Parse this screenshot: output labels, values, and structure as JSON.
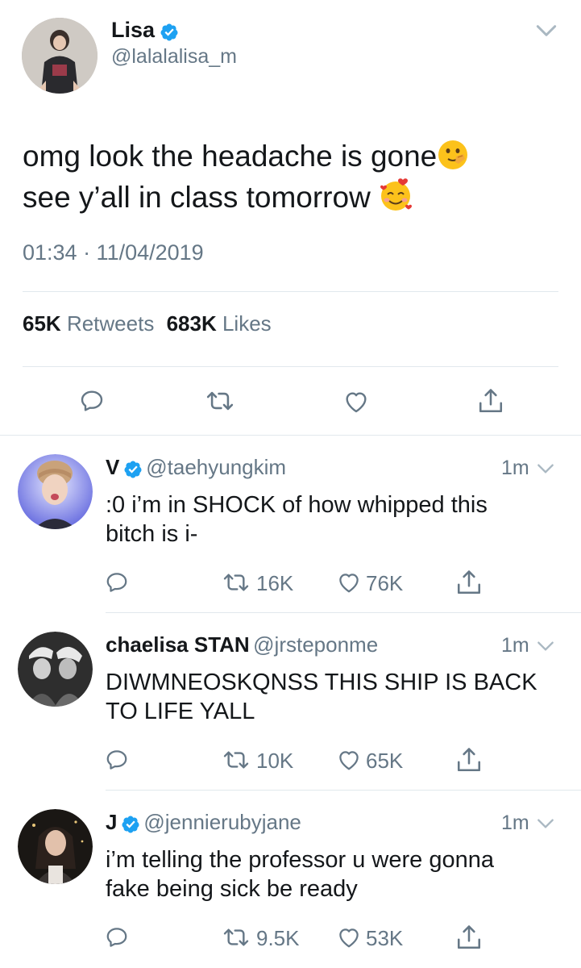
{
  "main_tweet": {
    "name": "Lisa",
    "handle": "@lalalalisa_m",
    "text_line1": "omg look the headache is gone",
    "text_line2": "see y’all in class tomorrow",
    "timestamp": "01:34 · 11/04/2019",
    "retweets_count": "65K",
    "retweets_label": "Retweets",
    "likes_count": "683K",
    "likes_label": "Likes"
  },
  "replies": [
    {
      "name": "V",
      "verified": true,
      "handle": "@taehyungkim",
      "time": "1m",
      "line1": ":0 i’m in SHOCK of how whipped this",
      "line2": "bitch is i-",
      "retweets": "16K",
      "likes": "76K"
    },
    {
      "name": "chaelisa STAN",
      "verified": false,
      "handle": "@jrsteponme",
      "time": "1m",
      "line1": "DIWMNEOSKQNSS THIS SHIP IS BACK",
      "line2": "TO LIFE YALL",
      "retweets": "10K",
      "likes": "65K"
    },
    {
      "name": "J",
      "verified": true,
      "handle": "@jennierubyjane",
      "time": "1m",
      "line1": "i’m telling the professor u were gonna",
      "line2": "fake being sick be ready",
      "retweets": "9.5K",
      "likes": "53K"
    }
  ],
  "colors": {
    "verified_blue": "#1da1f2",
    "text_primary": "#14171a",
    "text_secondary": "#657786",
    "divider": "#e1e8ed"
  },
  "icons": [
    "verified-badge-icon",
    "chevron-down-icon",
    "reply-icon",
    "retweet-icon",
    "like-icon",
    "share-icon",
    "shushing-face-emoji-icon",
    "smiling-face-with-hearts-emoji-icon"
  ]
}
